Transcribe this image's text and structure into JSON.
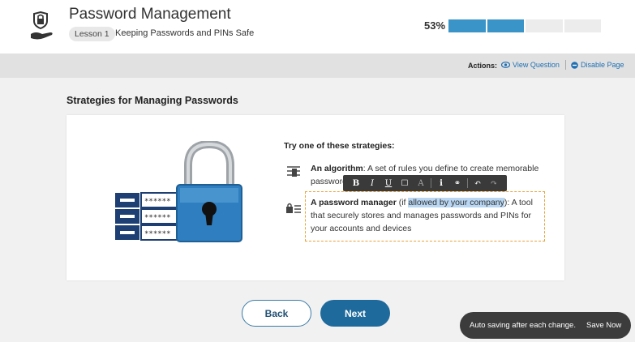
{
  "header": {
    "title": "Password Management",
    "lesson_badge": "Lesson 1",
    "lesson_title": "Keeping Passwords and PINs Safe",
    "progress_text": "53%",
    "progress_value": 0.53
  },
  "actions": {
    "label": "Actions:",
    "view_question": "View Question",
    "disable_page": "Disable Page"
  },
  "content": {
    "section_title": "Strategies for Managing Passwords",
    "try_label": "Try one of these strategies:",
    "strategy1": {
      "bold": "An algorithm",
      "text": ": A set of rules you define to create memorable passwords"
    },
    "strategy2": {
      "bold": "A password manager",
      "pre": " (if ",
      "highlight": "allowed by your company",
      "post": "): A tool that securely stores and manages passwords and PINs for your accounts and devices"
    },
    "password_mask": "******"
  },
  "format_toolbar": {
    "bold": "B",
    "italic": "I",
    "underline": "U",
    "box": "☐",
    "font": "A",
    "info": "i",
    "link": "⚭",
    "undo": "↶",
    "redo": "↷"
  },
  "nav": {
    "back": "Back",
    "next": "Next"
  },
  "toast": {
    "message": "Auto saving after each change.",
    "save_now": "Save Now"
  },
  "colors": {
    "accent": "#1f6a9c",
    "progress": "#3a94c8",
    "highlight_border": "#e8a33a"
  }
}
